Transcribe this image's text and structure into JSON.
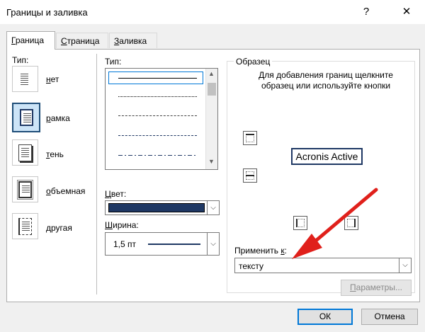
{
  "window": {
    "title": "Границы и заливка",
    "help_glyph": "?",
    "close_glyph": "✕"
  },
  "tabs": [
    {
      "label": "Граница",
      "accel": "Г",
      "rest": "раница",
      "active": true
    },
    {
      "label": "Страница",
      "accel": "С",
      "rest": "траница",
      "active": false
    },
    {
      "label": "Заливка",
      "accel": "З",
      "rest": "аливка",
      "active": false
    }
  ],
  "setting": {
    "label": "Тип:",
    "items": [
      {
        "label": "нет",
        "accel": "н",
        "rest": "ет",
        "icon": "page-no-border-icon",
        "selected": false
      },
      {
        "label": "рамка",
        "accel": "р",
        "rest": "амка",
        "icon": "page-box-icon",
        "selected": true
      },
      {
        "label": "тень",
        "accel": "т",
        "rest": "ень",
        "icon": "page-shadow-icon",
        "selected": false
      },
      {
        "label": "объемная",
        "accel": "о",
        "rest": "бъемная",
        "icon": "page-3d-icon",
        "selected": false
      },
      {
        "label": "другая",
        "accel": "д",
        "rest": "ругая",
        "icon": "page-custom-icon",
        "selected": false
      }
    ]
  },
  "style": {
    "label": "Тип:",
    "items": [
      "solid",
      "dotted",
      "dashed-small",
      "dashed",
      "dash-dot"
    ],
    "selected": "solid"
  },
  "color": {
    "label": "Цвет:",
    "accel": "Ц",
    "rest": "вет:",
    "value_hex": "#1f3864"
  },
  "width": {
    "label": "Ширина:",
    "accel": "Ш",
    "rest": "ирина:",
    "value": "1,5 пт"
  },
  "preview": {
    "legend": "Образец",
    "hint": "Для добавления границ щелкните образец или используйте кнопки",
    "sample_text": "Acronis Active"
  },
  "apply_to": {
    "label": "Применить к:",
    "label_main": "Применить ",
    "accel": "к",
    "label_tail": ":",
    "value": "тексту"
  },
  "buttons": {
    "options": "Параметры...",
    "options_accel": "П",
    "options_rest": "араметры...",
    "ok": "ОК",
    "cancel": "Отмена"
  },
  "colors": {
    "accent": "#0078d7",
    "border_navy": "#1f3864",
    "annotation": "#e0201b"
  }
}
